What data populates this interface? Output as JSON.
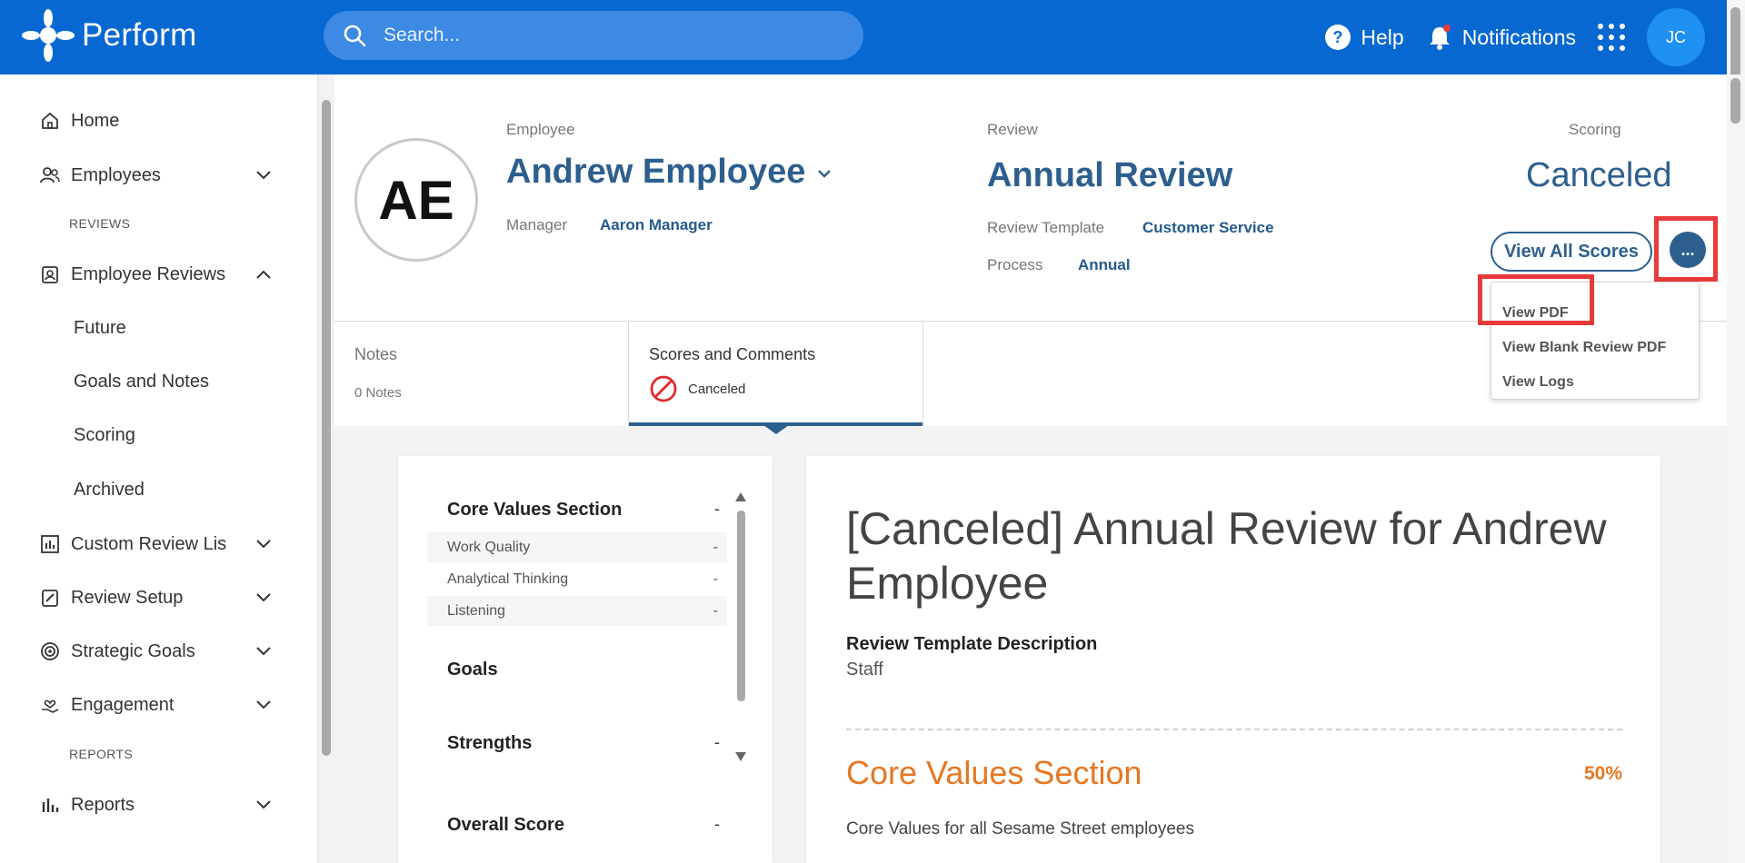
{
  "app": {
    "name": "Perform"
  },
  "search": {
    "placeholder": "Search..."
  },
  "topbar": {
    "help": "Help",
    "notifications": "Notifications",
    "user_initials": "JC"
  },
  "sidebar": {
    "home": "Home",
    "employees": "Employees",
    "reviews_heading": "REVIEWS",
    "employee_reviews": "Employee Reviews",
    "sub_items": [
      "Future",
      "Goals and Notes",
      "Scoring",
      "Archived"
    ],
    "custom_review_lists": "Custom Review Lis",
    "review_setup": "Review Setup",
    "strategic_goals": "Strategic Goals",
    "engagement": "Engagement",
    "reports_heading": "REPORTS",
    "reports": "Reports"
  },
  "header": {
    "avatar_initials": "AE",
    "employee_label": "Employee",
    "employee_name": "Andrew Employee",
    "manager_label": "Manager",
    "manager_name": "Aaron Manager",
    "review_label": "Review",
    "review_name": "Annual Review",
    "template_label": "Review Template",
    "template_value": "Customer Service",
    "process_label": "Process",
    "process_value": "Annual",
    "scoring_label": "Scoring",
    "scoring_value": "Canceled",
    "view_all_scores": "View All Scores",
    "more_label": "..."
  },
  "dropdown": {
    "items": [
      "View PDF",
      "View Blank Review PDF",
      "View Logs"
    ]
  },
  "tabs": {
    "notes_title": "Notes",
    "notes_sub": "0 Notes",
    "scores_title": "Scores and Comments",
    "scores_sub": "Canceled"
  },
  "nav_panel": {
    "core_values": "Core Values Section",
    "core_values_score": "-",
    "rows": [
      {
        "label": "Work Quality",
        "score": "-"
      },
      {
        "label": "Analytical Thinking",
        "score": "-"
      },
      {
        "label": "Listening",
        "score": "-"
      }
    ],
    "goals": "Goals",
    "strengths": "Strengths",
    "strengths_score": "-",
    "overall_score": "Overall Score",
    "overall_score_value": "-"
  },
  "review_panel": {
    "title": "[Canceled] Annual Review for Andrew Employee",
    "template_description_label": "Review Template Description",
    "template_description_value": "Staff",
    "section_title": "Core Values Section",
    "section_percent": "50%",
    "section_description": "Core Values for all Sesame Street employees"
  },
  "colors": {
    "brand": "#0868d1",
    "accent": "#2d5f8e",
    "orange": "#e67722",
    "highlight": "#e83a3a"
  }
}
